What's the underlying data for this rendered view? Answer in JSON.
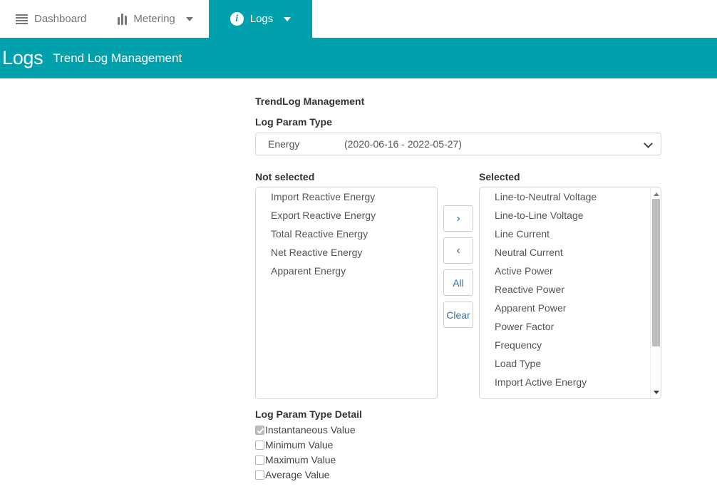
{
  "navbar": {
    "items": [
      {
        "label": "Dashboard",
        "icon": "list-icon",
        "active": false,
        "has_caret": false
      },
      {
        "label": "Metering",
        "icon": "bar-chart-icon",
        "active": false,
        "has_caret": true
      },
      {
        "label": "Logs",
        "icon": "info-icon",
        "active": true,
        "has_caret": true
      }
    ]
  },
  "banner": {
    "title": "Logs",
    "subtitle": "Trend Log Management",
    "color": "#00a0ac"
  },
  "form": {
    "section_title": "TrendLog Management",
    "log_param_type_label": "Log Param Type",
    "select": {
      "value_name": "Energy",
      "value_range": "(2020-06-16 - 2022-05-27)",
      "chevron": "chevron-down-icon"
    },
    "not_selected": {
      "heading": "Not selected",
      "options": [
        "Import Reactive Energy",
        "Export Reactive Energy",
        "Total Reactive Energy",
        "Net Reactive Energy",
        "Apparent Energy"
      ]
    },
    "selected": {
      "heading": "Selected",
      "options": [
        "Line-to-Neutral Voltage",
        "Line-to-Line Voltage",
        "Line Current",
        "Neutral Current",
        "Active Power",
        "Reactive Power",
        "Apparent Power",
        "Power Factor",
        "Frequency",
        "Load Type",
        "Import Active Energy"
      ]
    },
    "transfer_buttons": [
      {
        "label": "›",
        "name": "move-right-button"
      },
      {
        "label": "‹",
        "name": "move-left-button"
      },
      {
        "label": "All",
        "name": "select-all-button"
      },
      {
        "label": "Clear",
        "name": "clear-button"
      }
    ],
    "detail": {
      "heading": "Log Param Type Detail",
      "checkboxes": [
        {
          "label": "Instantaneous Value",
          "checked": true
        },
        {
          "label": "Minimum Value",
          "checked": false
        },
        {
          "label": "Maximum Value",
          "checked": false
        },
        {
          "label": "Average Value",
          "checked": false
        }
      ]
    }
  }
}
